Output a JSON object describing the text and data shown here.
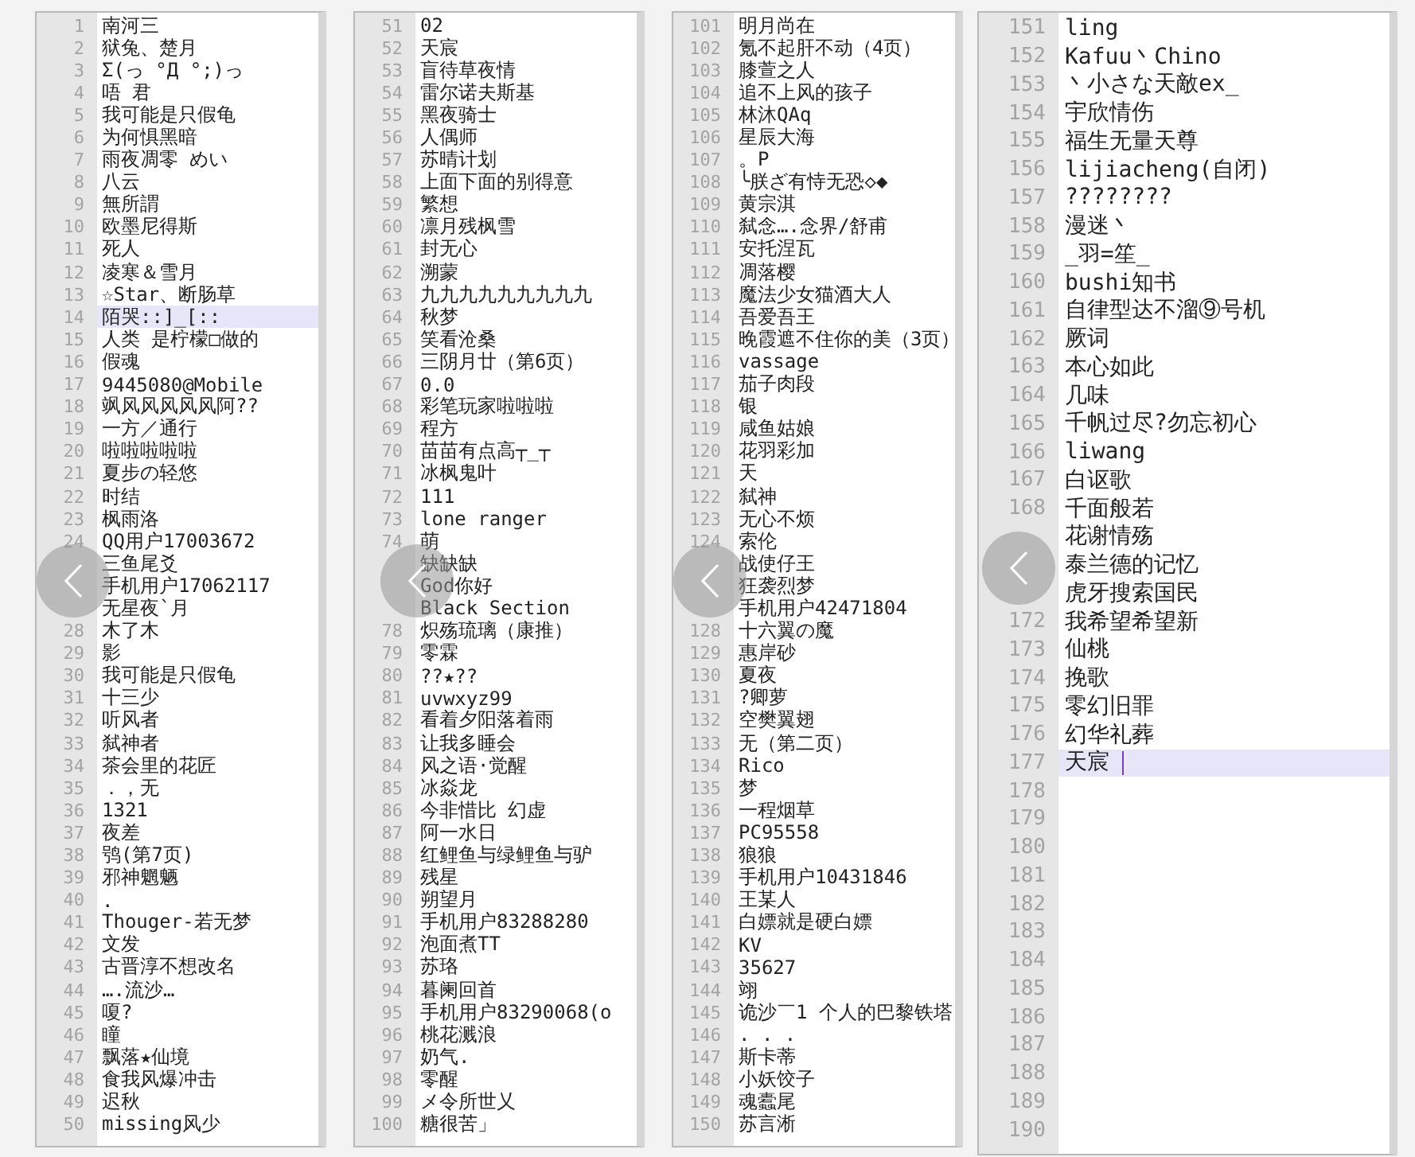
{
  "panels": [
    {
      "kind": "compact",
      "lines": [
        {
          "number": "1",
          "text": "南河三",
          "selected": false
        },
        {
          "number": "2",
          "text": "狱兔、楚月",
          "selected": false
        },
        {
          "number": "3",
          "text": "Σ(っ °Д °;)っ",
          "selected": false
        },
        {
          "number": "4",
          "text": "唔 君",
          "selected": false
        },
        {
          "number": "5",
          "text": "我可能是只假龟",
          "selected": false
        },
        {
          "number": "6",
          "text": "为何惧黑暗",
          "selected": false
        },
        {
          "number": "7",
          "text": "雨夜凋零 めい",
          "selected": false
        },
        {
          "number": "8",
          "text": "八云",
          "selected": false
        },
        {
          "number": "9",
          "text": "無所謂",
          "selected": false
        },
        {
          "number": "10",
          "text": "欧墨尼得斯",
          "selected": false
        },
        {
          "number": "11",
          "text": "死人",
          "selected": false
        },
        {
          "number": "12",
          "text": "凌寒＆雪月",
          "selected": false
        },
        {
          "number": "13",
          "text": "☆Star、断肠草",
          "selected": false
        },
        {
          "number": "14",
          "text": "陌哭::]_[::",
          "selected": true
        },
        {
          "number": "15",
          "text": "人类 是柠檬□做的",
          "selected": false
        },
        {
          "number": "16",
          "text": "假魂",
          "selected": false
        },
        {
          "number": "17",
          "text": "9445080@Mobile",
          "selected": false
        },
        {
          "number": "18",
          "text": "飒风风风风风阿??",
          "selected": false
        },
        {
          "number": "19",
          "text": "一方／通行",
          "selected": false
        },
        {
          "number": "20",
          "text": "啦啦啦啦啦",
          "selected": false
        },
        {
          "number": "21",
          "text": "夏步の轻悠",
          "selected": false
        },
        {
          "number": "22",
          "text": "时结",
          "selected": false
        },
        {
          "number": "23",
          "text": "枫雨洛",
          "selected": false
        },
        {
          "number": "24",
          "text": "QQ用户17003672",
          "selected": false
        },
        {
          "text": "三鱼尾爻",
          "selected": false
        },
        {
          "text": "手机用户17062117",
          "selected": false
        },
        {
          "text": "无星夜`月",
          "selected": false
        },
        {
          "number": "28",
          "text": "木了木",
          "selected": false
        },
        {
          "number": "29",
          "text": "影",
          "selected": false
        },
        {
          "number": "30",
          "text": "我可能是只假龟",
          "selected": false
        },
        {
          "number": "31",
          "text": "十三少",
          "selected": false
        },
        {
          "number": "32",
          "text": "听风者",
          "selected": false
        },
        {
          "number": "33",
          "text": "弑神者",
          "selected": false
        },
        {
          "number": "34",
          "text": "茶会里的花匠",
          "selected": false
        },
        {
          "number": "35",
          "text": "．，无",
          "selected": false
        },
        {
          "number": "36",
          "text": "1321",
          "selected": false
        },
        {
          "number": "37",
          "text": "夜差",
          "selected": false
        },
        {
          "number": "38",
          "text": "鸮(第7页)",
          "selected": false
        },
        {
          "number": "39",
          "text": "邪神魍魉",
          "selected": false
        },
        {
          "number": "40",
          "text": ".",
          "selected": false
        },
        {
          "number": "41",
          "text": "Thouger-若无梦",
          "selected": false
        },
        {
          "number": "42",
          "text": "文发",
          "selected": false
        },
        {
          "number": "43",
          "text": "古晋淳不想改名",
          "selected": false
        },
        {
          "number": "44",
          "text": "….流沙…",
          "selected": false
        },
        {
          "number": "45",
          "text": "嗄?",
          "selected": false
        },
        {
          "number": "46",
          "text": "瞳",
          "selected": false
        },
        {
          "number": "47",
          "text": "飘落★仙境",
          "selected": false
        },
        {
          "number": "48",
          "text": "食我风爆冲击",
          "selected": false
        },
        {
          "number": "49",
          "text": "迟秋",
          "selected": false
        },
        {
          "number": "50",
          "text": "missing风少",
          "selected": false
        }
      ]
    },
    {
      "kind": "compact",
      "lines": [
        {
          "number": "51",
          "text": "02",
          "selected": false
        },
        {
          "number": "52",
          "text": "天宸",
          "selected": false
        },
        {
          "number": "53",
          "text": "盲待草夜情",
          "selected": false
        },
        {
          "number": "54",
          "text": "雷尔诺夫斯基",
          "selected": false
        },
        {
          "number": "55",
          "text": "黑夜骑士",
          "selected": false
        },
        {
          "number": "56",
          "text": "人偶师",
          "selected": false
        },
        {
          "number": "57",
          "text": "苏晴计划",
          "selected": false
        },
        {
          "number": "58",
          "text": "上面下面的别得意",
          "selected": false
        },
        {
          "number": "59",
          "text": "繁想",
          "selected": false
        },
        {
          "number": "60",
          "text": "凛月残枫雪",
          "selected": false
        },
        {
          "number": "61",
          "text": "封无心",
          "selected": false
        },
        {
          "number": "62",
          "text": "溯蒙",
          "selected": false
        },
        {
          "number": "63",
          "text": "九九九九九九九九九",
          "selected": false
        },
        {
          "number": "64",
          "text": "秋梦",
          "selected": false
        },
        {
          "number": "65",
          "text": "笑看沧桑",
          "selected": false
        },
        {
          "number": "66",
          "text": "三阴月廿（第6页）",
          "selected": false
        },
        {
          "number": "67",
          "text": "0.0",
          "selected": false
        },
        {
          "number": "68",
          "text": "彩笔玩家啦啦啦",
          "selected": false
        },
        {
          "number": "69",
          "text": "程方",
          "selected": false
        },
        {
          "number": "70",
          "text": "苗苗有点高┬_┬",
          "selected": false
        },
        {
          "number": "71",
          "text": "冰枫鬼叶",
          "selected": false
        },
        {
          "number": "72",
          "text": "111",
          "selected": false
        },
        {
          "number": "73",
          "text": "lone ranger",
          "selected": false
        },
        {
          "number": "74",
          "text": "萌",
          "selected": false
        },
        {
          "text": "缺缺缺",
          "selected": false
        },
        {
          "text": "God你好",
          "selected": false
        },
        {
          "text": "Black Section",
          "selected": false
        },
        {
          "number": "78",
          "text": "炽殇琉璃（康推）",
          "selected": false
        },
        {
          "number": "79",
          "text": "零霖",
          "selected": false
        },
        {
          "number": "80",
          "text": "??★??",
          "selected": false
        },
        {
          "number": "81",
          "text": "uvwxyz99",
          "selected": false
        },
        {
          "number": "82",
          "text": "看着夕阳落着雨",
          "selected": false
        },
        {
          "number": "83",
          "text": "让我多睡会",
          "selected": false
        },
        {
          "number": "84",
          "text": "风之语·觉醒",
          "selected": false
        },
        {
          "number": "85",
          "text": "冰焱龙",
          "selected": false
        },
        {
          "number": "86",
          "text": "今非惜比 幻虚",
          "selected": false
        },
        {
          "number": "87",
          "text": "阿一水日",
          "selected": false
        },
        {
          "number": "88",
          "text": "红鲤鱼与绿鲤鱼与驴",
          "selected": false
        },
        {
          "number": "89",
          "text": "残星",
          "selected": false
        },
        {
          "number": "90",
          "text": "朔望月",
          "selected": false
        },
        {
          "number": "91",
          "text": "手机用户83288280",
          "selected": false
        },
        {
          "number": "92",
          "text": "泡面煮TT",
          "selected": false
        },
        {
          "number": "93",
          "text": "苏珞",
          "selected": false
        },
        {
          "number": "94",
          "text": "暮阑回首",
          "selected": false
        },
        {
          "number": "95",
          "text": "手机用户83290068(o",
          "selected": false
        },
        {
          "number": "96",
          "text": "桃花溅浪",
          "selected": false
        },
        {
          "number": "97",
          "text": "奶气.",
          "selected": false
        },
        {
          "number": "98",
          "text": "零醒",
          "selected": false
        },
        {
          "number": "99",
          "text": "メ令所世乂",
          "selected": false
        },
        {
          "number": "100",
          "text": "糖很苦」",
          "selected": false
        }
      ]
    },
    {
      "kind": "compact",
      "lines": [
        {
          "number": "101",
          "text": "明月尚在",
          "selected": false
        },
        {
          "number": "102",
          "text": "氪不起肝不动（4页）",
          "selected": false
        },
        {
          "number": "103",
          "text": "膝萱之人",
          "selected": false
        },
        {
          "number": "104",
          "text": "追不上风的孩子",
          "selected": false
        },
        {
          "number": "105",
          "text": "林沐QAq",
          "selected": false
        },
        {
          "number": "106",
          "text": "星辰大海",
          "selected": false
        },
        {
          "number": "107",
          "text": "。P",
          "selected": false
        },
        {
          "number": "108",
          "text": "╰朕ざ有恃无恐◇◆",
          "selected": false
        },
        {
          "number": "109",
          "text": "黄宗淇",
          "selected": false
        },
        {
          "number": "110",
          "text": "弑念….念界/舒甫",
          "selected": false
        },
        {
          "number": "111",
          "text": "安托涅瓦",
          "selected": false
        },
        {
          "number": "112",
          "text": "凋落樱",
          "selected": false
        },
        {
          "number": "113",
          "text": "魔法少女猫酒大人",
          "selected": false
        },
        {
          "number": "114",
          "text": "吾爱吾王",
          "selected": false
        },
        {
          "number": "115",
          "text": "晚霞遮不住你的美（3页）",
          "selected": false
        },
        {
          "number": "116",
          "text": "vassage",
          "selected": false
        },
        {
          "number": "117",
          "text": "茄子肉段",
          "selected": false
        },
        {
          "number": "118",
          "text": "银",
          "selected": false
        },
        {
          "number": "119",
          "text": "咸鱼姑娘",
          "selected": false
        },
        {
          "number": "120",
          "text": "花羽彩加",
          "selected": false
        },
        {
          "number": "121",
          "text": "天",
          "selected": false
        },
        {
          "number": "122",
          "text": "弑神",
          "selected": false
        },
        {
          "number": "123",
          "text": "无心不烦",
          "selected": false
        },
        {
          "number": "124",
          "text": "索伦",
          "selected": false
        },
        {
          "text": "战使仔王",
          "selected": false
        },
        {
          "text": "狂袭烈梦",
          "selected": false
        },
        {
          "text": "手机用户42471804",
          "selected": false
        },
        {
          "number": "128",
          "text": "十六翼の魔",
          "selected": false
        },
        {
          "number": "129",
          "text": "惠岸砂",
          "selected": false
        },
        {
          "number": "130",
          "text": "夏夜",
          "selected": false
        },
        {
          "number": "131",
          "text": "?卿萝",
          "selected": false
        },
        {
          "number": "132",
          "text": "空樊翼翅",
          "selected": false
        },
        {
          "number": "133",
          "text": "无（第二页）",
          "selected": false
        },
        {
          "number": "134",
          "text": "Rico",
          "selected": false
        },
        {
          "number": "135",
          "text": "梦",
          "selected": false
        },
        {
          "number": "136",
          "text": "一程烟草",
          "selected": false
        },
        {
          "number": "137",
          "text": "PC95558",
          "selected": false
        },
        {
          "number": "138",
          "text": "狼狼",
          "selected": false
        },
        {
          "number": "139",
          "text": "手机用户10431846",
          "selected": false
        },
        {
          "number": "140",
          "text": "王某人",
          "selected": false
        },
        {
          "number": "141",
          "text": "白嫖就是硬白嫖",
          "selected": false
        },
        {
          "number": "142",
          "text": "KV",
          "selected": false
        },
        {
          "number": "143",
          "text": "35627",
          "selected": false
        },
        {
          "number": "144",
          "text": "翊",
          "selected": false
        },
        {
          "number": "145",
          "text": "诡沙￣1 个人的巴黎铁塔",
          "selected": false
        },
        {
          "number": "146",
          "text": ". . .",
          "selected": false
        },
        {
          "number": "147",
          "text": "斯卡蒂",
          "selected": false
        },
        {
          "number": "148",
          "text": "小妖饺子",
          "selected": false
        },
        {
          "number": "149",
          "text": "魂蠹尾",
          "selected": false
        },
        {
          "number": "150",
          "text": "苏言淅",
          "selected": false
        }
      ]
    },
    {
      "kind": "large",
      "lines": [
        {
          "number": "151",
          "text": "ling",
          "selected": false
        },
        {
          "number": "152",
          "text": "Kafuu丶Chino",
          "selected": false
        },
        {
          "number": "153",
          "text": "丶小さな天敵ex_",
          "selected": false
        },
        {
          "number": "154",
          "text": "宇欣情伤",
          "selected": false
        },
        {
          "number": "155",
          "text": "福生无量天尊",
          "selected": false
        },
        {
          "number": "156",
          "text": "lijiacheng(自闭)",
          "selected": false
        },
        {
          "number": "157",
          "text": "????????",
          "selected": false
        },
        {
          "number": "158",
          "text": "漫迷丶",
          "selected": false
        },
        {
          "number": "159",
          "text": "_羽=笙_",
          "selected": false
        },
        {
          "number": "160",
          "text": "bushi知书",
          "selected": false
        },
        {
          "number": "161",
          "text": "自律型达不溜⑨号机",
          "selected": false
        },
        {
          "number": "162",
          "text": "厥词",
          "selected": false
        },
        {
          "number": "163",
          "text": "本心如此",
          "selected": false
        },
        {
          "number": "164",
          "text": "几味",
          "selected": false
        },
        {
          "number": "165",
          "text": "千帆过尽?勿忘初心",
          "selected": false
        },
        {
          "number": "166",
          "text": "liwang",
          "selected": false
        },
        {
          "number": "167",
          "text": "白讴歌",
          "selected": false
        },
        {
          "number": "168",
          "text": "千面般若",
          "selected": false
        },
        {
          "text": "花谢情殇",
          "selected": false
        },
        {
          "text": "泰兰德的记忆",
          "selected": false
        },
        {
          "text": "虎牙搜索国民",
          "selected": false
        },
        {
          "number": "172",
          "text": "我希望希望新",
          "selected": false
        },
        {
          "number": "173",
          "text": "仙桃",
          "selected": false
        },
        {
          "number": "174",
          "text": "挽歌",
          "selected": false
        },
        {
          "number": "175",
          "text": "零幻旧罪",
          "selected": false
        },
        {
          "number": "176",
          "text": "幻华礼葬",
          "selected": false
        },
        {
          "number": "177",
          "text": "天宸",
          "selected": true
        },
        {
          "number": "178",
          "selected": false
        },
        {
          "number": "179",
          "selected": false
        },
        {
          "number": "180",
          "selected": false
        },
        {
          "number": "181",
          "selected": false
        },
        {
          "number": "182",
          "selected": false
        },
        {
          "number": "183",
          "selected": false
        },
        {
          "number": "184",
          "selected": false
        },
        {
          "number": "185",
          "selected": false
        },
        {
          "number": "186",
          "selected": false
        },
        {
          "number": "187",
          "selected": false
        },
        {
          "number": "188",
          "selected": false
        },
        {
          "number": "189",
          "selected": false
        },
        {
          "number": "190",
          "selected": false
        }
      ]
    }
  ]
}
